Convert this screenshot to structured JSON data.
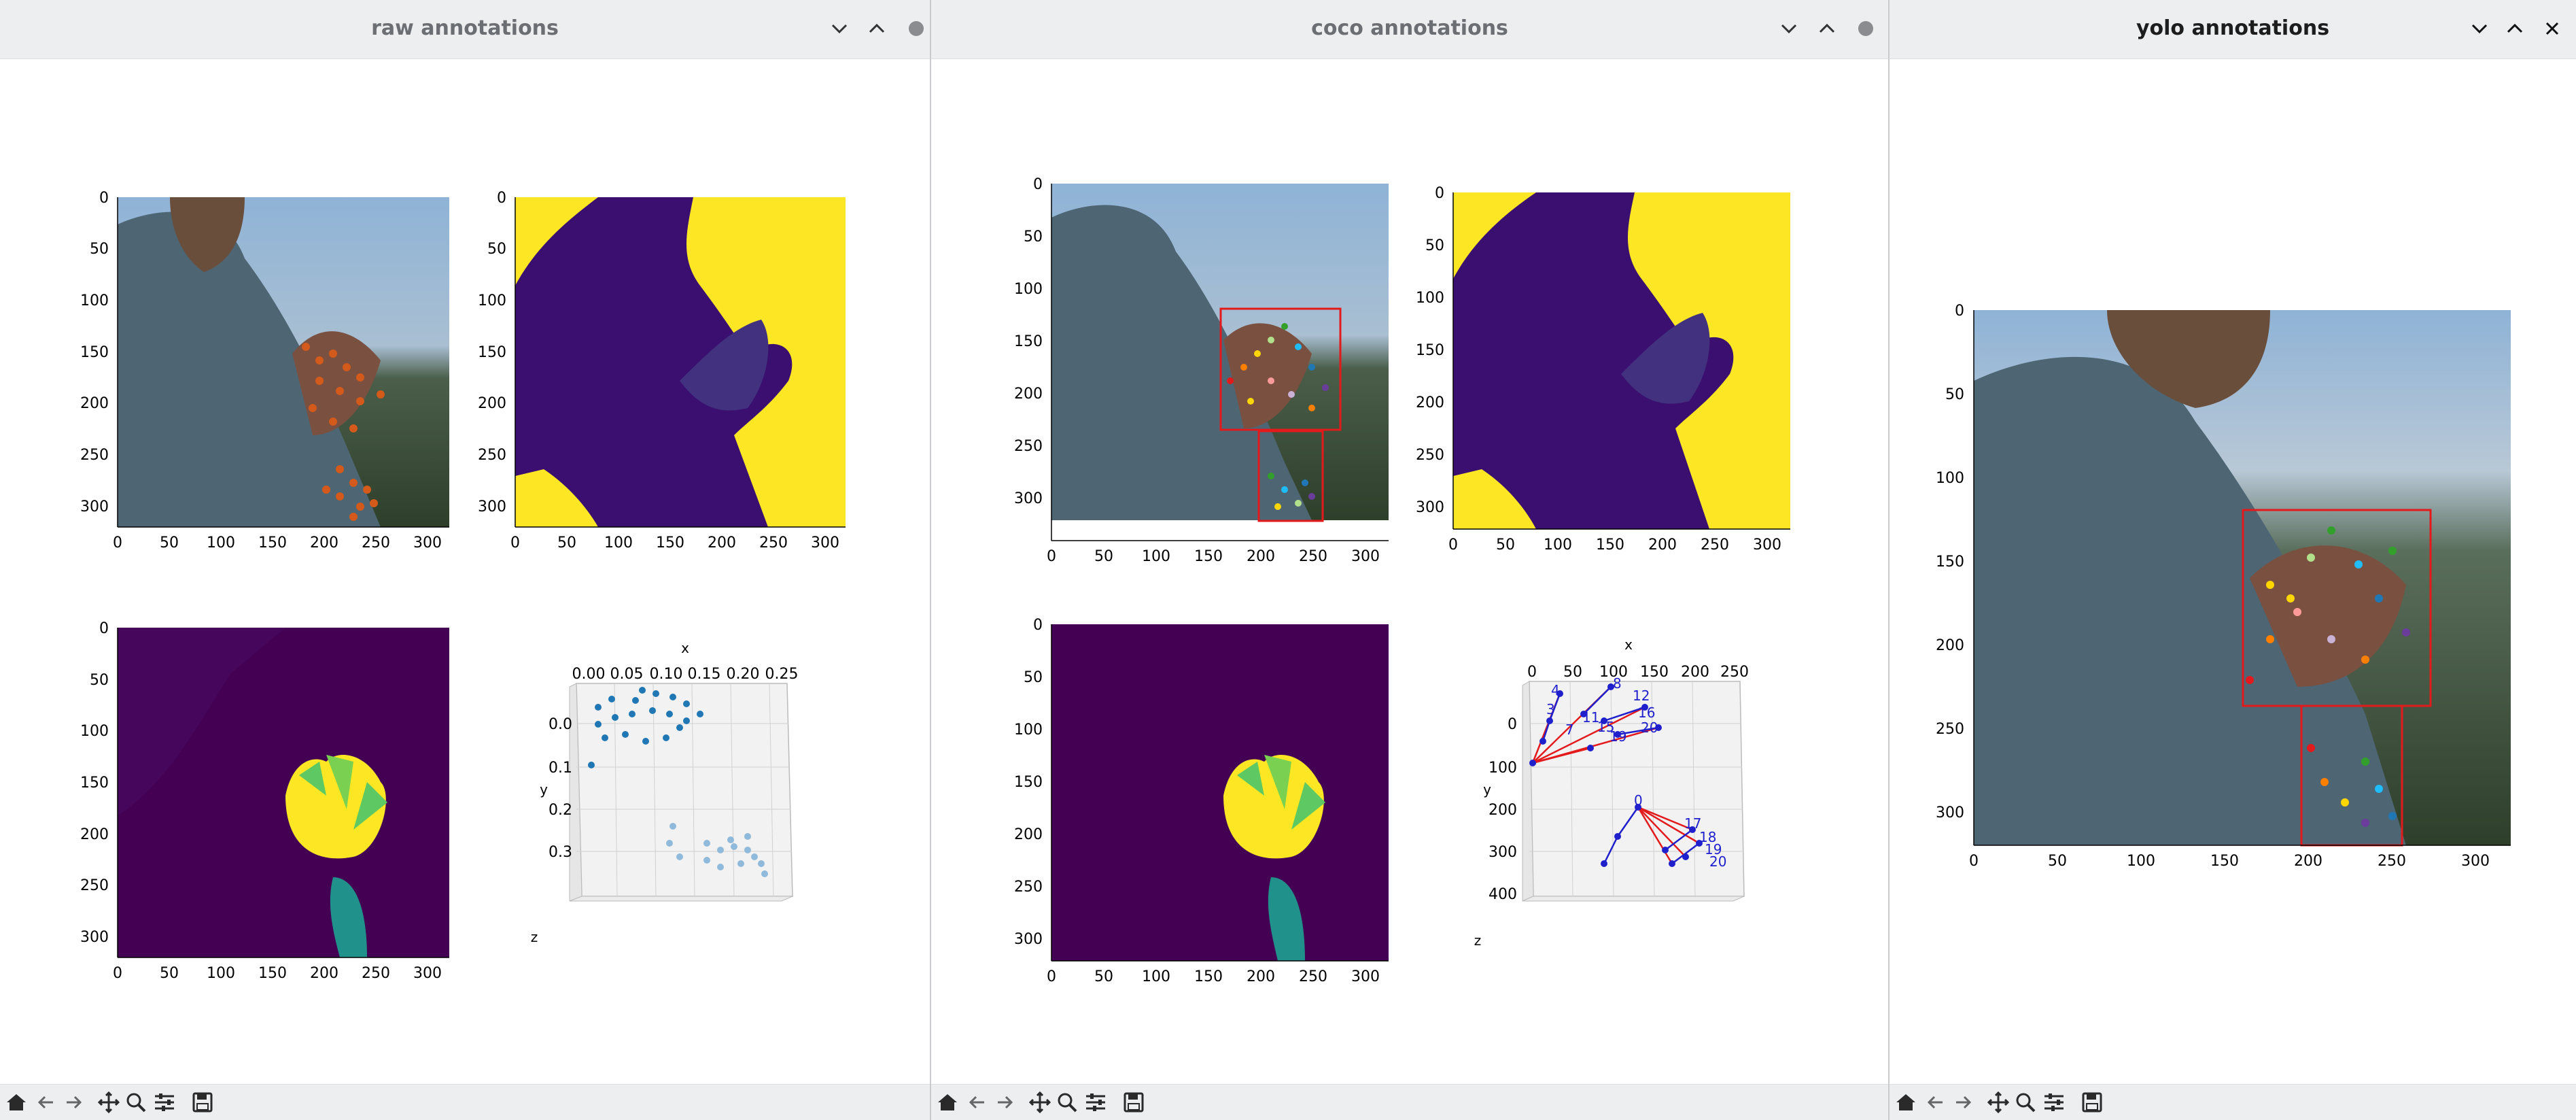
{
  "windows": [
    {
      "title": "raw annotations",
      "panels": [
        "rgb image with keypoints",
        "segmentation mask",
        "depth map",
        "3d keypoint scatter"
      ],
      "ticks": [
        "0",
        "50",
        "100",
        "150",
        "200",
        "250",
        "300"
      ],
      "scatter": {
        "x_label": "x",
        "y_label": "y",
        "z_label": "z",
        "x_ticks": [
          "0.00",
          "0.05",
          "0.10",
          "0.15",
          "0.20",
          "0.25"
        ],
        "y_ticks": [
          "0.0",
          "0.1",
          "0.2",
          "0.3"
        ]
      }
    },
    {
      "title": "coco annotations",
      "panels": [
        "rgb image with boxes and keypoints",
        "segmentation mask",
        "depth map",
        "3d keypoint skeleton"
      ],
      "ticks": [
        "0",
        "50",
        "100",
        "150",
        "200",
        "250",
        "300"
      ],
      "skeleton": {
        "x_label": "x",
        "y_label": "y",
        "z_label": "z",
        "x_ticks": [
          "0",
          "50",
          "100",
          "150",
          "200",
          "250"
        ],
        "y_ticks": [
          "0",
          "100",
          "200",
          "300",
          "400"
        ],
        "point_labels": [
          "4",
          "3",
          "8",
          "12",
          "16",
          "20",
          "7",
          "11",
          "15",
          "19",
          "0",
          "17",
          "18",
          "19",
          "20"
        ]
      }
    },
    {
      "title": "yolo annotations",
      "panels": [
        "rgb image with yolo boxes and keypoints"
      ],
      "x_ticks": [
        "0",
        "50",
        "100",
        "150",
        "200",
        "250",
        "300"
      ],
      "y_ticks": [
        "0",
        "50",
        "100",
        "150",
        "200",
        "250",
        "300"
      ]
    }
  ],
  "toolbar": [
    "home-icon",
    "back-icon",
    "forward-icon",
    "pan-icon",
    "zoom-icon",
    "configure-icon",
    "save-icon"
  ],
  "colors": {
    "mask_purple": "#3b0f6f",
    "mask_yellow": "#fde725",
    "box_red": "#e31a1c",
    "skeleton_blue": "#1f1fcc",
    "scatter_blue": "#1f77b4"
  }
}
